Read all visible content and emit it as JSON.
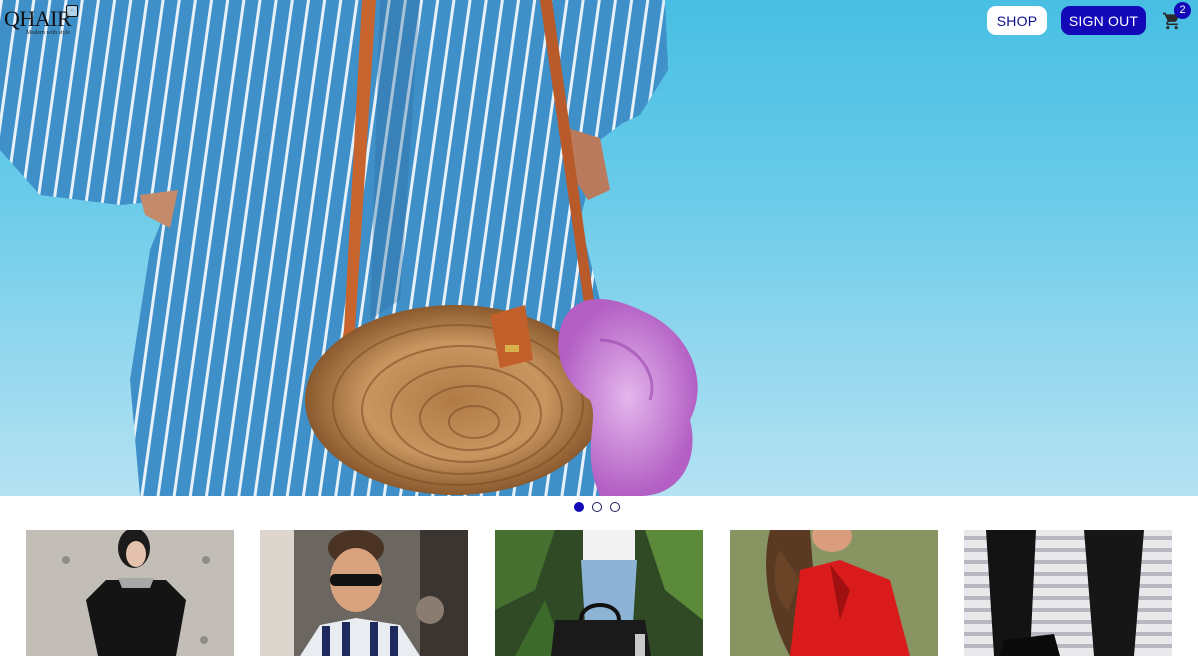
{
  "brand": {
    "logo_text": "QHAIR",
    "tagline": "Modern with style",
    "accent_color": "#1208b8"
  },
  "nav": {
    "shop_label": "SHOP",
    "signout_label": "SIGN OUT",
    "cart_icon": "shopping-cart-icon",
    "cart_count": "2"
  },
  "hero": {
    "image": "woman-striped-dress-rattan-bag-photo",
    "slide_count": 3,
    "active_slide": 1
  },
  "products": [
    {
      "image": "woman-black-dress-photo"
    },
    {
      "image": "man-sunglasses-striped-shirt-photo"
    },
    {
      "image": "black-handbag-photo"
    },
    {
      "image": "woman-red-leather-jacket-photo"
    },
    {
      "image": "black-trousers-shoes-photo"
    }
  ]
}
